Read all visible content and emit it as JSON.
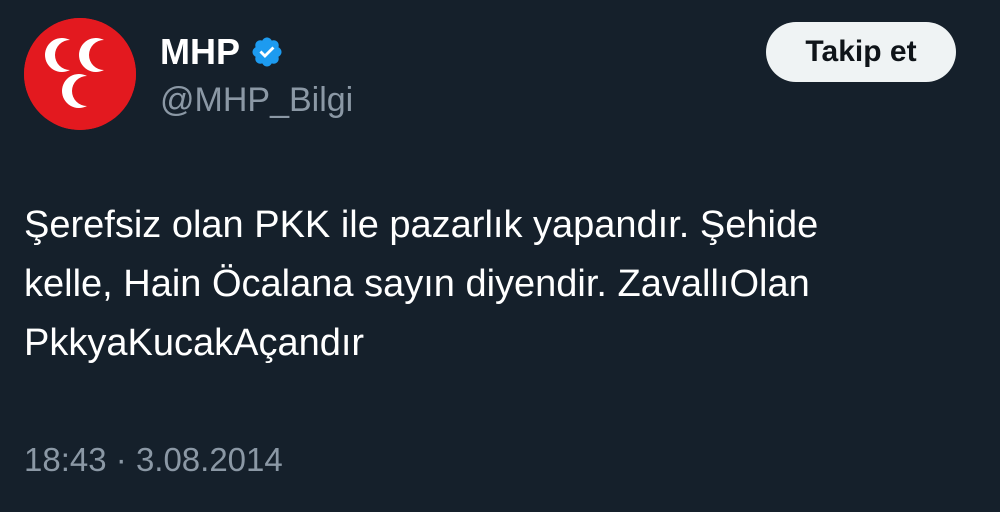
{
  "author": {
    "display_name": "MHP",
    "handle": "@MHP_Bilgi",
    "verified_icon": "verified-badge-icon",
    "avatar_icon": "mhp-three-crescents-logo"
  },
  "follow_button": {
    "label": "Takip et"
  },
  "tweet": {
    "text": "Şerefsiz olan PKK ile pazarlık yapandır. Şehide\nkelle, Hain Öcalana sayın diyendir. ZavallıOlan\nPkkyaKucakAçandır",
    "time": "18:43",
    "separator": "·",
    "date": "3.08.2014"
  },
  "colors": {
    "background": "#15202b",
    "text_primary": "#ffffff",
    "text_secondary": "#8b98a5",
    "verified_blue": "#1d9bf0",
    "avatar_red": "#e3191f",
    "button_bg": "#eff3f4",
    "button_text": "#0f1419"
  }
}
